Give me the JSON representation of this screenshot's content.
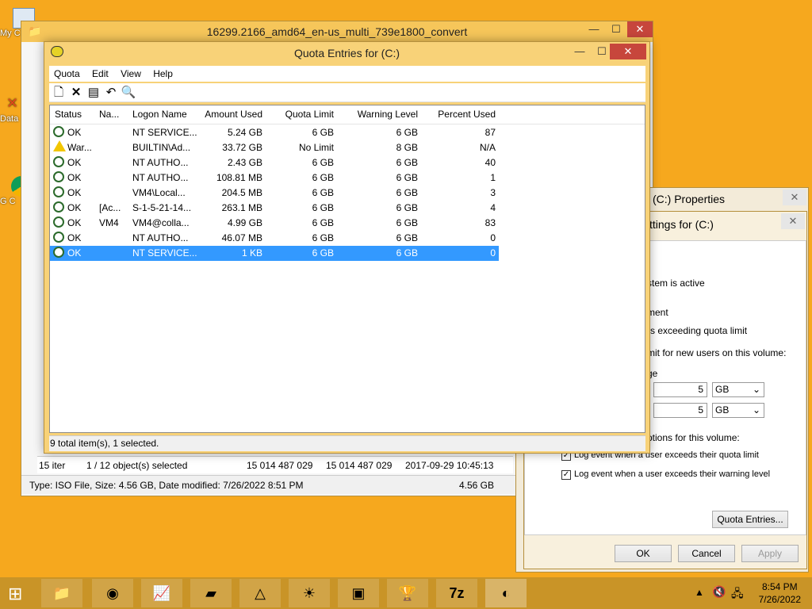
{
  "back_window": {
    "title": "16299.2166_amd64_en-us_multi_739e1800_convert",
    "selection_left": "15 iter",
    "selection_text": "1 / 12 object(s) selected",
    "size1": "15 014 487 029",
    "size2": "15 014 487 029",
    "date": "2017-09-29 10:45:13",
    "status_text": "Type: ISO File, Size: 4.56 GB, Date modified: 7/26/2022 8:51 PM",
    "status_size": "4.56 GB"
  },
  "props_window": {
    "title": "(C:) Properties",
    "inner_title": "ttings for  (C:)",
    "line1": "stem is active",
    "line2": "ment",
    "line3": "rs exceeding quota limit",
    "line4": "mit for new users on this volume:",
    "line5": "ge",
    "limit_value": "5",
    "limit_unit": "GB",
    "warn_value": "5",
    "warn_unit": "GB",
    "line6": "ptions for this volume:",
    "log_limit": "Log event when a user exceeds their quota limit",
    "log_warning": "Log event when a user exceeds their warning level",
    "quota_entries_btn": "Quota Entries...",
    "ok_btn": "OK",
    "cancel_btn": "Cancel",
    "apply_btn": "Apply"
  },
  "main_window": {
    "title": "Quota Entries for  (C:)",
    "menu": [
      "Quota",
      "Edit",
      "View",
      "Help"
    ],
    "columns": [
      "Status",
      "Na...",
      "Logon Name",
      "Amount Used",
      "Quota Limit",
      "Warning Level",
      "Percent Used"
    ],
    "rows": [
      {
        "status": "OK",
        "name": "",
        "logon": "NT SERVICE...",
        "used": "5.24 GB",
        "limit": "6 GB",
        "warn": "6 GB",
        "pct": "87",
        "icon": "ok"
      },
      {
        "status": "War...",
        "name": "",
        "logon": "BUILTIN\\Ad...",
        "used": "33.72 GB",
        "limit": "No Limit",
        "warn": "8 GB",
        "pct": "N/A",
        "icon": "warning"
      },
      {
        "status": "OK",
        "name": "",
        "logon": "NT AUTHO...",
        "used": "2.43 GB",
        "limit": "6 GB",
        "warn": "6 GB",
        "pct": "40",
        "icon": "ok"
      },
      {
        "status": "OK",
        "name": "",
        "logon": "NT AUTHO...",
        "used": "108.81 MB",
        "limit": "6 GB",
        "warn": "6 GB",
        "pct": "1",
        "icon": "ok"
      },
      {
        "status": "OK",
        "name": "",
        "logon": "VM4\\Local...",
        "used": "204.5 MB",
        "limit": "6 GB",
        "warn": "6 GB",
        "pct": "3",
        "icon": "ok"
      },
      {
        "status": "OK",
        "name": "[Ac...",
        "logon": "S-1-5-21-14...",
        "used": "263.1 MB",
        "limit": "6 GB",
        "warn": "6 GB",
        "pct": "4",
        "icon": "ok"
      },
      {
        "status": "OK",
        "name": "VM4",
        "logon": "VM4@colla...",
        "used": "4.99 GB",
        "limit": "6 GB",
        "warn": "6 GB",
        "pct": "83",
        "icon": "ok"
      },
      {
        "status": "OK",
        "name": "",
        "logon": "NT AUTHO...",
        "used": "46.07 MB",
        "limit": "6 GB",
        "warn": "6 GB",
        "pct": "0",
        "icon": "ok"
      },
      {
        "status": "OK",
        "name": "",
        "logon": "NT SERVICE...",
        "used": "1 KB",
        "limit": "6 GB",
        "warn": "6 GB",
        "pct": "0",
        "icon": "ok"
      }
    ],
    "status_text": "9 total item(s), 1 selected."
  },
  "desktop": {
    "icon1_label": "My C",
    "icon2_label": "Data",
    "icon3_label": "G C"
  },
  "taskbar": {
    "time": "8:54 PM",
    "date": "7/26/2022"
  }
}
